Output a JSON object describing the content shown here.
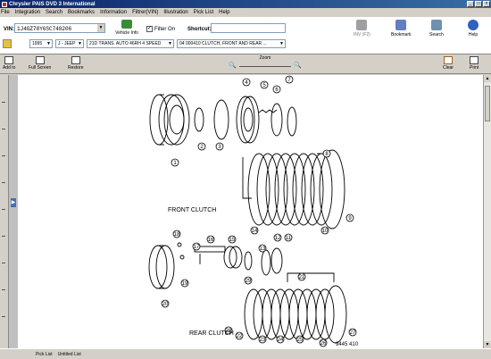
{
  "window": {
    "title": "Chrysler PAIS DVD 3 International",
    "minimize": "_",
    "maximize": "□",
    "close": "×"
  },
  "menu": [
    "File",
    "Integration",
    "Search",
    "Bookmarks",
    "Information",
    "Filtrer(VIN)",
    "Illustration",
    "Pick List",
    "Help"
  ],
  "vin": {
    "label": "VIN:",
    "value": "1J4GZ78Y6SC748206",
    "dropdown_glyph": "▼"
  },
  "vehicle_info": "Vehicle Info",
  "filter": {
    "label": "Filter On",
    "checked": true,
    "check_glyph": "✓"
  },
  "shortcut": {
    "label": "Shortcut:",
    "value": ""
  },
  "tools": {
    "inv": "INV (F2)",
    "bookmark": "Bookmark",
    "search": "Search",
    "help": "Help"
  },
  "selectors": {
    "year": "1995",
    "make": "J - JEEP",
    "group": "21D TRANS. AUTO 46RH 4 SPEED",
    "section": "04  000410 CLUTCH, FRONT AND REAR ..."
  },
  "toolbar2": {
    "add": "Add to",
    "fullscreen": "Full Screen",
    "restore": "Restore",
    "zoom": "Zoom",
    "zoom_out_glyph": "🔍",
    "zoom_in_glyph": "🔍",
    "clear": "Clear",
    "print": "Print"
  },
  "splitter_arrow": "▶",
  "scroll_up_glyph": "▲",
  "scroll_down_glyph": "▼",
  "illustration": {
    "front_label": "FRONT CLUTCH",
    "rear_label": "REAR CLUTCH",
    "ref": "9445 410",
    "callouts": [
      "1",
      "2",
      "3",
      "4",
      "5",
      "6",
      "7",
      "8",
      "9",
      "10",
      "11",
      "12",
      "13",
      "14",
      "15",
      "16",
      "17",
      "18",
      "19",
      "20",
      "21",
      "22",
      "23",
      "24",
      "25",
      "26",
      "27",
      "28",
      "29"
    ]
  },
  "status": {
    "pick_list": "Pick List",
    "list_name": "Untitled List"
  }
}
